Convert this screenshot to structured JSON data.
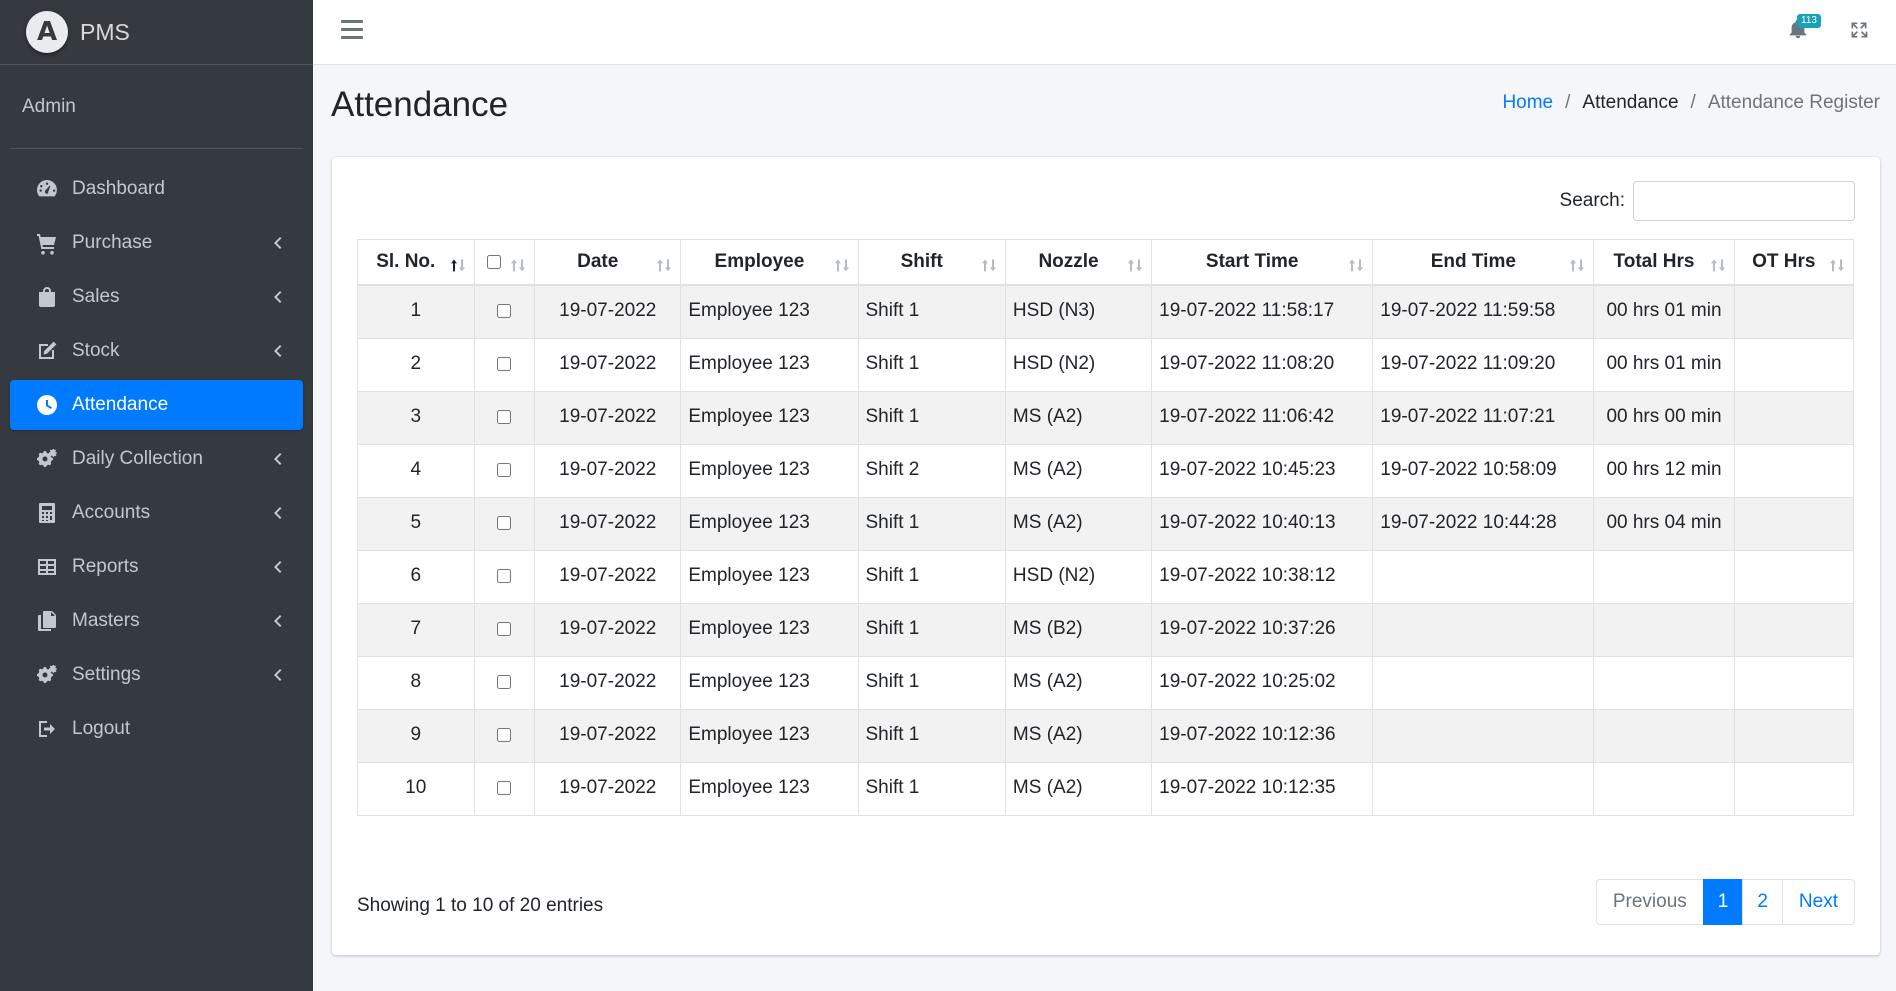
{
  "brand": {
    "name": "PMS",
    "logo_letter": "A"
  },
  "user": {
    "name": "Admin"
  },
  "nav": [
    {
      "label": "Dashboard",
      "icon": "tachometer-icon",
      "has_caret": false,
      "active": false
    },
    {
      "label": "Purchase",
      "icon": "cart-icon",
      "has_caret": true,
      "active": false
    },
    {
      "label": "Sales",
      "icon": "shopping-bag-icon",
      "has_caret": true,
      "active": false
    },
    {
      "label": "Stock",
      "icon": "edit-icon",
      "has_caret": true,
      "active": false
    },
    {
      "label": "Attendance",
      "icon": "clock-icon",
      "has_caret": false,
      "active": true
    },
    {
      "label": "Daily Collection",
      "icon": "cogs-icon",
      "has_caret": true,
      "active": false
    },
    {
      "label": "Accounts",
      "icon": "calculator-icon",
      "has_caret": true,
      "active": false
    },
    {
      "label": "Reports",
      "icon": "table-icon",
      "has_caret": true,
      "active": false
    },
    {
      "label": "Masters",
      "icon": "copy-icon",
      "has_caret": true,
      "active": false
    },
    {
      "label": "Settings",
      "icon": "cogs-icon",
      "has_caret": true,
      "active": false
    },
    {
      "label": "Logout",
      "icon": "sign-out-icon",
      "has_caret": false,
      "active": false
    }
  ],
  "header": {
    "notification_count": "113"
  },
  "page": {
    "title": "Attendance",
    "breadcrumb": {
      "home": "Home",
      "section": "Attendance",
      "current": "Attendance Register"
    }
  },
  "search": {
    "label": "Search:",
    "value": ""
  },
  "table": {
    "columns": [
      "Sl. No.",
      "",
      "Date",
      "Employee",
      "Shift",
      "Nozzle",
      "Start Time",
      "End Time",
      "Total Hrs",
      "OT Hrs"
    ],
    "rows": [
      [
        "1",
        "19-07-2022",
        "Employee 123",
        "Shift 1",
        "HSD (N3)",
        "19-07-2022 11:58:17",
        "19-07-2022 11:59:58",
        "00 hrs 01 min",
        ""
      ],
      [
        "2",
        "19-07-2022",
        "Employee 123",
        "Shift 1",
        "HSD (N2)",
        "19-07-2022 11:08:20",
        "19-07-2022 11:09:20",
        "00 hrs 01 min",
        ""
      ],
      [
        "3",
        "19-07-2022",
        "Employee 123",
        "Shift 1",
        "MS (A2)",
        "19-07-2022 11:06:42",
        "19-07-2022 11:07:21",
        "00 hrs 00 min",
        ""
      ],
      [
        "4",
        "19-07-2022",
        "Employee 123",
        "Shift 2",
        "MS (A2)",
        "19-07-2022 10:45:23",
        "19-07-2022 10:58:09",
        "00 hrs 12 min",
        ""
      ],
      [
        "5",
        "19-07-2022",
        "Employee 123",
        "Shift 1",
        "MS (A2)",
        "19-07-2022 10:40:13",
        "19-07-2022 10:44:28",
        "00 hrs 04 min",
        ""
      ],
      [
        "6",
        "19-07-2022",
        "Employee 123",
        "Shift 1",
        "HSD (N2)",
        "19-07-2022 10:38:12",
        "",
        "",
        ""
      ],
      [
        "7",
        "19-07-2022",
        "Employee 123",
        "Shift 1",
        "MS (B2)",
        "19-07-2022 10:37:26",
        "",
        "",
        ""
      ],
      [
        "8",
        "19-07-2022",
        "Employee 123",
        "Shift 1",
        "MS (A2)",
        "19-07-2022 10:25:02",
        "",
        "",
        ""
      ],
      [
        "9",
        "19-07-2022",
        "Employee 123",
        "Shift 1",
        "MS (A2)",
        "19-07-2022 10:12:36",
        "",
        "",
        ""
      ],
      [
        "10",
        "19-07-2022",
        "Employee 123",
        "Shift 1",
        "MS (A2)",
        "19-07-2022 10:12:35",
        "",
        "",
        ""
      ]
    ]
  },
  "footer": {
    "info": "Showing 1 to 10 of 20 entries",
    "pagination": {
      "previous": "Previous",
      "pages": [
        "1",
        "2"
      ],
      "active_page": "1",
      "next": "Next"
    }
  },
  "colors": {
    "sidebar_bg": "#343a40",
    "accent": "#007bff",
    "badge": "#17a2b8"
  }
}
